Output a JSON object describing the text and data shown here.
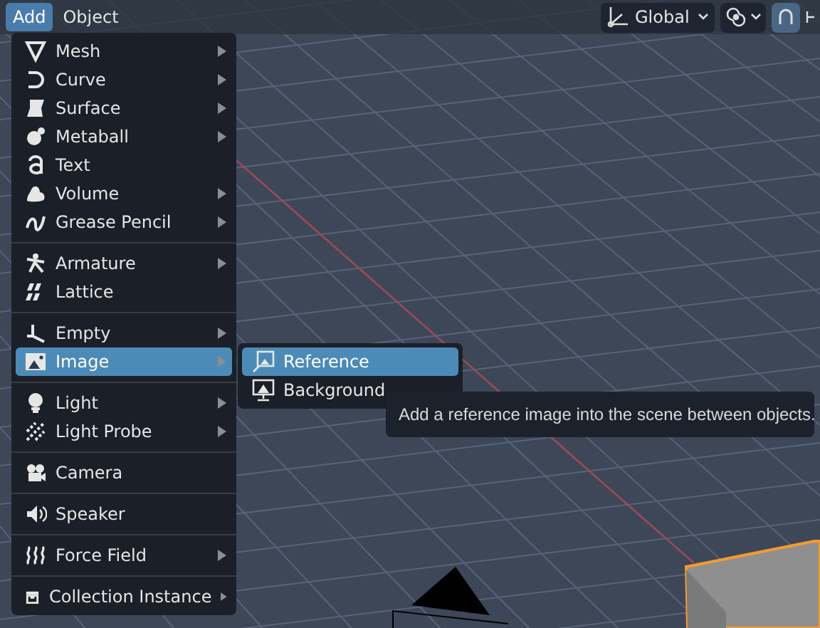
{
  "menu_bar": [
    {
      "label": "Add",
      "selected": true
    },
    {
      "label": "Object",
      "selected": false
    }
  ],
  "header_tools": {
    "orientation": "Global",
    "snap_enabled": true
  },
  "add_menu": {
    "groups": [
      {
        "items": [
          {
            "label": "Mesh",
            "submenu": true,
            "selected": false
          },
          {
            "label": "Curve",
            "submenu": true,
            "selected": false
          },
          {
            "label": "Surface",
            "submenu": true,
            "selected": false
          },
          {
            "label": "Metaball",
            "submenu": true,
            "selected": false
          },
          {
            "label": "Text",
            "submenu": false,
            "selected": false
          },
          {
            "label": "Volume",
            "submenu": true,
            "selected": false
          },
          {
            "label": "Grease Pencil",
            "submenu": true,
            "selected": false
          }
        ]
      },
      {
        "items": [
          {
            "label": "Armature",
            "submenu": true,
            "selected": false
          },
          {
            "label": "Lattice",
            "submenu": false,
            "selected": false
          }
        ]
      },
      {
        "items": [
          {
            "label": "Empty",
            "submenu": true,
            "selected": false
          },
          {
            "label": "Image",
            "submenu": true,
            "selected": true
          }
        ]
      },
      {
        "items": [
          {
            "label": "Light",
            "submenu": true,
            "selected": false
          },
          {
            "label": "Light Probe",
            "submenu": true,
            "selected": false
          }
        ]
      },
      {
        "items": [
          {
            "label": "Camera",
            "submenu": false,
            "selected": false
          }
        ]
      },
      {
        "items": [
          {
            "label": "Speaker",
            "submenu": false,
            "selected": false
          }
        ]
      },
      {
        "items": [
          {
            "label": "Force Field",
            "submenu": true,
            "selected": false
          }
        ]
      },
      {
        "items": [
          {
            "label": "Collection Instance",
            "submenu": true,
            "selected": false
          }
        ]
      }
    ]
  },
  "image_submenu": [
    {
      "label": "Reference",
      "selected": true
    },
    {
      "label": "Background",
      "selected": false
    }
  ],
  "tooltip": "Add a reference image into the scene between objects."
}
